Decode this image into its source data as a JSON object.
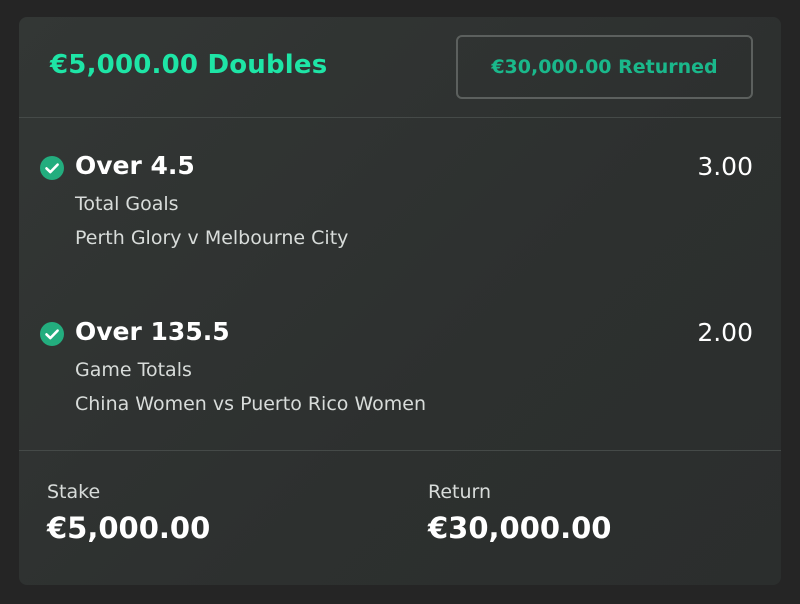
{
  "header": {
    "title": "€5,000.00 Doubles",
    "returned_label": "€30,000.00  Returned"
  },
  "selections": [
    {
      "name": "Over 4.5",
      "odds": "3.00",
      "market": "Total Goals",
      "event": "Perth Glory v Melbourne City",
      "status_icon": "check-circle-icon"
    },
    {
      "name": "Over 135.5",
      "odds": "2.00",
      "market": "Game Totals",
      "event": "China Women vs Puerto Rico Women",
      "status_icon": "check-circle-icon"
    }
  ],
  "footer": {
    "stake_label": "Stake",
    "stake_value": "€5,000.00",
    "return_label": "Return",
    "return_value": "€30,000.00"
  },
  "colors": {
    "accent": "#1ee5a6",
    "check": "#23ad7e",
    "card_bg": "#313433",
    "page_bg": "#252525"
  }
}
